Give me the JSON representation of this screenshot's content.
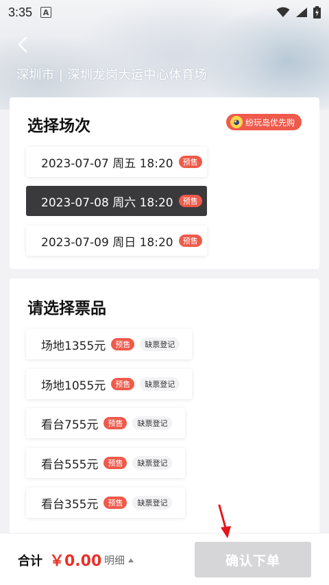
{
  "status_bar": {
    "time": "3:35",
    "notification_icon_letter": "A",
    "icons": [
      "wifi-icon",
      "signal-icon",
      "battery-charging-icon"
    ]
  },
  "header": {
    "venue_title": "深圳市 | 深圳龙岗大运中心体育场",
    "back_icon": "chevron-left-icon"
  },
  "session_section": {
    "title": "选择场次",
    "promo_badge": "纷玩岛优先购",
    "options": [
      {
        "label": "2023-07-07 周五 18:20",
        "tag": "预售",
        "selected": false
      },
      {
        "label": "2023-07-08 周六 18:20",
        "tag": "预售",
        "selected": true
      },
      {
        "label": "2023-07-09 周日 18:20",
        "tag": "预售",
        "selected": false
      }
    ]
  },
  "ticket_section": {
    "title": "请选择票品",
    "options": [
      {
        "label": "场地1355元",
        "tag": "预售",
        "status": "缺票登记"
      },
      {
        "label": "场地1055元",
        "tag": "预售",
        "status": "缺票登记"
      },
      {
        "label": "看台755元",
        "tag": "预售",
        "status": "缺票登记"
      },
      {
        "label": "看台555元",
        "tag": "预售",
        "status": "缺票登记"
      },
      {
        "label": "看台355元",
        "tag": "预售",
        "status": "缺票登记"
      }
    ]
  },
  "footer": {
    "total_label": "合计",
    "total_amount": "￥0.00",
    "detail_label": "明细",
    "confirm_label": "确认下单"
  },
  "colors": {
    "accent_red": "#ef5a4b",
    "price_red": "#e8332a",
    "selected_bg": "#3a3a3c",
    "disabled_button": "#d6d6d8"
  }
}
